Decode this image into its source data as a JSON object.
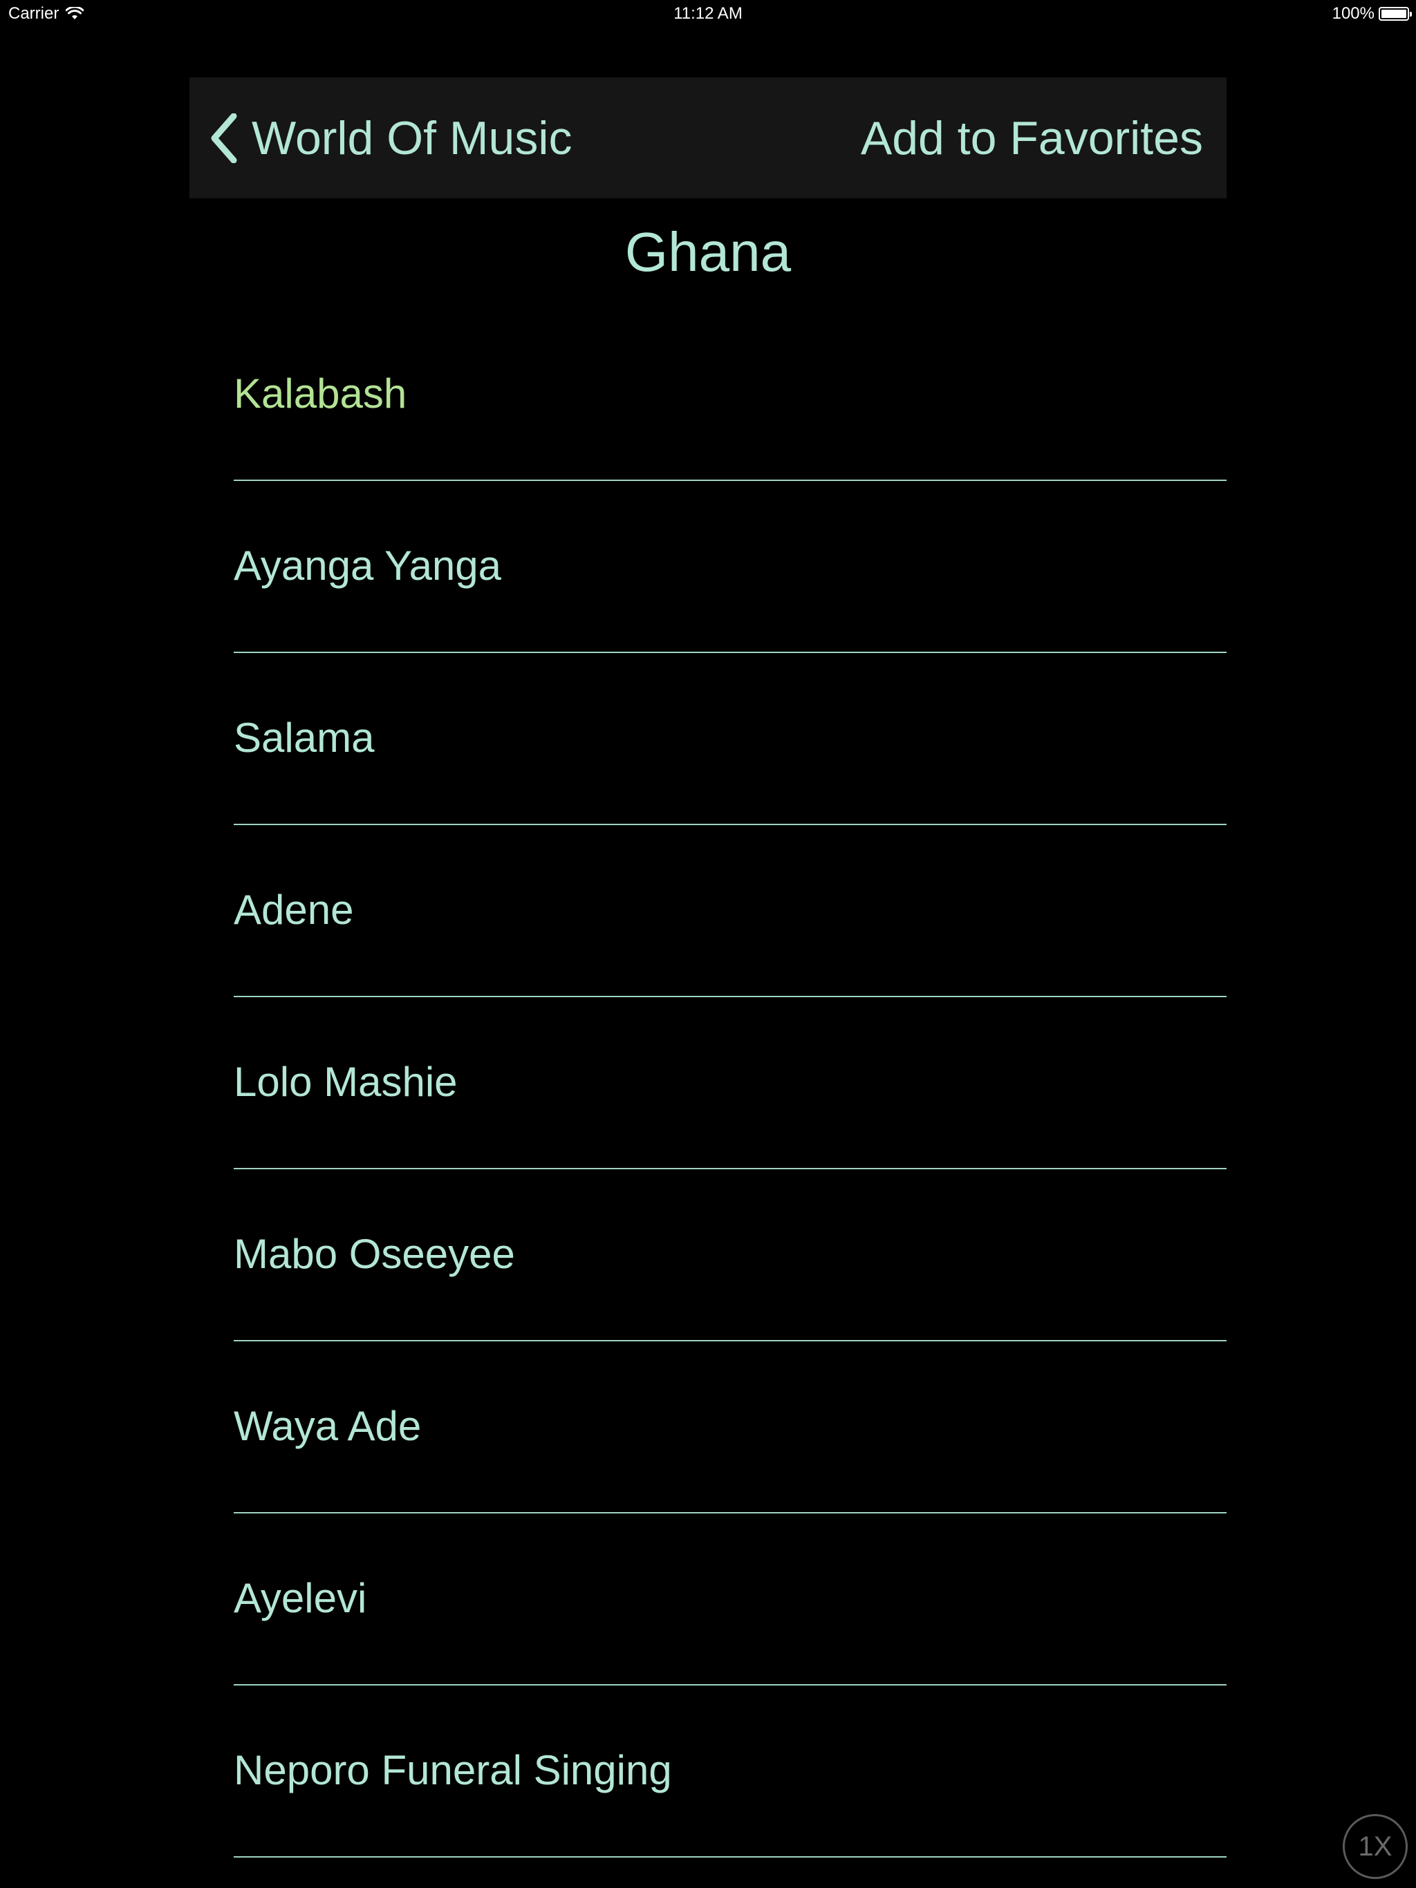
{
  "status_bar": {
    "carrier": "Carrier",
    "time": "11:12 AM",
    "battery": "100%",
    "battery_level": 1.0
  },
  "nav": {
    "back_label": "World Of Music",
    "right_button_label": "Add to Favorites"
  },
  "page": {
    "title": "Ghana"
  },
  "songs": [
    {
      "label": "Kalabash",
      "active": true
    },
    {
      "label": "Ayanga Yanga",
      "active": false
    },
    {
      "label": "Salama",
      "active": false
    },
    {
      "label": "Adene",
      "active": false
    },
    {
      "label": "Lolo Mashie",
      "active": false
    },
    {
      "label": "Mabo Oseeyee",
      "active": false
    },
    {
      "label": "Waya Ade",
      "active": false
    },
    {
      "label": "Ayelevi",
      "active": false
    },
    {
      "label": "Neporo Funeral Singing",
      "active": false
    }
  ],
  "speed_button": {
    "label": "1X"
  },
  "colors": {
    "background": "#000000",
    "text": "#b3e6d6",
    "active_text": "#b3e395",
    "nav_background": "#161616",
    "separator": "#9fd4c3"
  },
  "icons": {
    "back": "chevron-left-icon",
    "wifi": "wifi-icon",
    "battery": "battery-icon"
  }
}
